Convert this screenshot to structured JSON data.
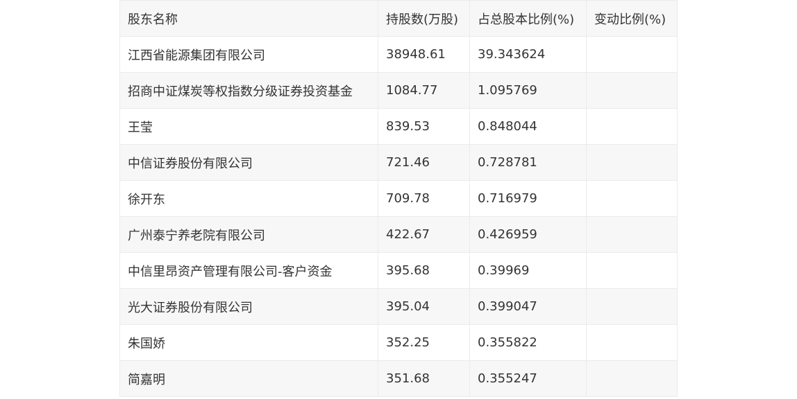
{
  "table": {
    "headers": [
      "股东名称",
      "持股数(万股)",
      "占总股本比例(%)",
      "变动比例(%)"
    ],
    "rows": [
      [
        "江西省能源集团有限公司",
        "38948.61",
        "39.343624",
        ""
      ],
      [
        "招商中证煤炭等权指数分级证券投资基金",
        "1084.77",
        "1.095769",
        ""
      ],
      [
        "王莹",
        "839.53",
        "0.848044",
        ""
      ],
      [
        "中信证券股份有限公司",
        "721.46",
        "0.728781",
        ""
      ],
      [
        "徐开东",
        "709.78",
        "0.716979",
        ""
      ],
      [
        "广州泰宁养老院有限公司",
        "422.67",
        "0.426959",
        ""
      ],
      [
        "中信里昂资产管理有限公司-客户资金",
        "395.68",
        "0.39969",
        ""
      ],
      [
        "光大证券股份有限公司",
        "395.04",
        "0.399047",
        ""
      ],
      [
        "朱国娇",
        "352.25",
        "0.355822",
        ""
      ],
      [
        "简嘉明",
        "351.68",
        "0.355247",
        ""
      ]
    ]
  }
}
